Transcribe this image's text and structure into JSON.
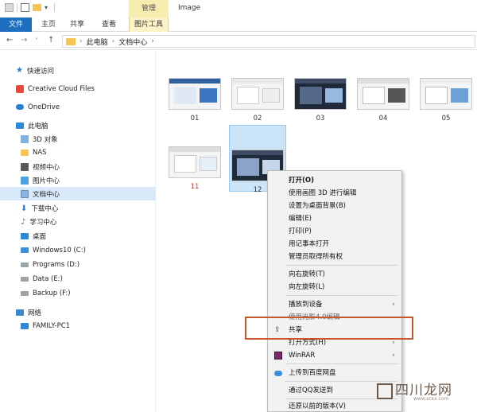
{
  "titlebar": {
    "context_tab": "管理",
    "title": "Image"
  },
  "ribbon_tabs": [
    "文件",
    "主页",
    "共享",
    "查看",
    "图片工具"
  ],
  "address": {
    "crumbs": [
      "此电脑",
      "文档中心"
    ]
  },
  "sidebar": {
    "items": [
      {
        "label": "快速访问",
        "icon": "star-icon"
      },
      {
        "label": "Creative Cloud Files",
        "icon": "creative-cloud-icon"
      },
      {
        "label": "OneDrive",
        "icon": "onedrive-icon"
      },
      {
        "label": "此电脑",
        "icon": "pc-icon"
      },
      {
        "label": "3D 对象",
        "icon": "3d-objects-icon"
      },
      {
        "label": "NAS",
        "icon": "folder-icon"
      },
      {
        "label": "视频中心",
        "icon": "video-icon"
      },
      {
        "label": "图片中心",
        "icon": "picture-icon"
      },
      {
        "label": "文档中心",
        "icon": "document-icon"
      },
      {
        "label": "下载中心",
        "icon": "download-icon"
      },
      {
        "label": "学习中心",
        "icon": "music-icon"
      },
      {
        "label": "桌面",
        "icon": "desktop-icon"
      },
      {
        "label": "Windows10 (C:)",
        "icon": "windows-drive-icon"
      },
      {
        "label": "Programs (D:)",
        "icon": "drive-icon"
      },
      {
        "label": "Data (E:)",
        "icon": "drive-icon"
      },
      {
        "label": "Backup (F:)",
        "icon": "drive-icon"
      },
      {
        "label": "网络",
        "icon": "network-icon"
      },
      {
        "label": "FAMILY-PC1",
        "icon": "computer-icon"
      }
    ]
  },
  "files": [
    {
      "name": "01"
    },
    {
      "name": "02"
    },
    {
      "name": "03"
    },
    {
      "name": "04"
    },
    {
      "name": "05"
    },
    {
      "name": "11"
    },
    {
      "name": "12"
    }
  ],
  "context_menu": {
    "items": [
      "打开(O)",
      "使用画图 3D 进行编辑",
      "设置为桌面背景(B)",
      "编辑(E)",
      "打印(P)",
      "用记事本打开",
      "管理员取得所有权",
      "向右旋转(T)",
      "向左旋转(L)",
      "播放到设备",
      "使用光影4.0编辑",
      "共享",
      "打开方式(H)",
      "WinRAR",
      "上传到百度网盘",
      "通过QQ发送到",
      "还原以前的版本(V)"
    ]
  },
  "watermark": {
    "text": "四川龙网",
    "sub": "www.scxx.com"
  },
  "colors": {
    "accent": "#1e6fbf",
    "selection": "#cce4f7",
    "highlight_box": "#c8552c",
    "context_tab": "#f7ecb0"
  }
}
